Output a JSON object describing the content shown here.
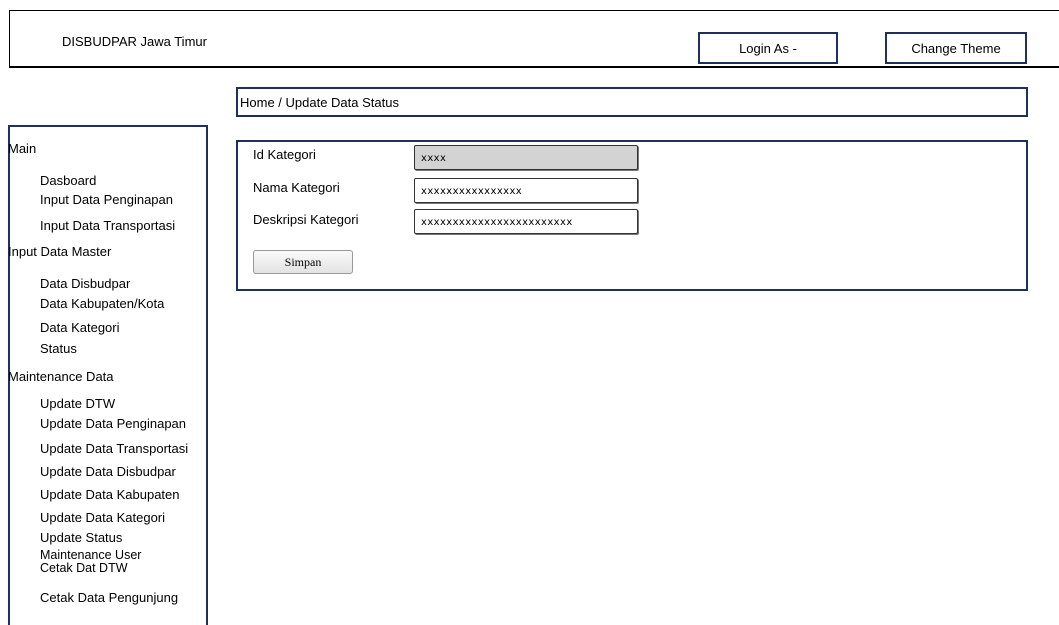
{
  "header": {
    "app_title": "DISBUDPAR Jawa Timur",
    "login_label": "Login As -",
    "theme_label": "Change Theme"
  },
  "breadcrumb": "Home / Update Data Status",
  "sidebar": {
    "main": "Main",
    "dashboard": "Dasboard",
    "input_penginapan": "Input Data Penginapan",
    "input_transportasi": "Input Data Transportasi",
    "input_master": "Input Data Master",
    "data_disbudpar": "Data Disbudpar",
    "data_kabupaten": "Data Kabupaten/Kota",
    "data_kategori": "Data Kategori",
    "status": "Status",
    "maintenance": "Maintenance Data",
    "update_dtw": "Update DTW",
    "update_penginapan": "Update Data Penginapan",
    "update_transportasi": "Update Data Transportasi",
    "update_disbudpar": "Update Data Disbudpar",
    "update_kabupaten": "Update Data Kabupaten",
    "update_kategori": "Update Data Kategori",
    "update_status": "Update Status",
    "maintenance_user": "Maintenance User",
    "cetak_dtw": "Cetak Dat DTW",
    "cetak_pengunjung": "Cetak Data Pengunjung"
  },
  "form": {
    "id_label": "Id Kategori",
    "id_value": "xxxx",
    "nama_label": "Nama Kategori",
    "nama_value": "xxxxxxxxxxxxxxxx",
    "deskripsi_label": "Deskripsi Kategori",
    "deskripsi_value": "xxxxxxxxxxxxxxxxxxxxxxxx",
    "save_label": "Simpan"
  }
}
